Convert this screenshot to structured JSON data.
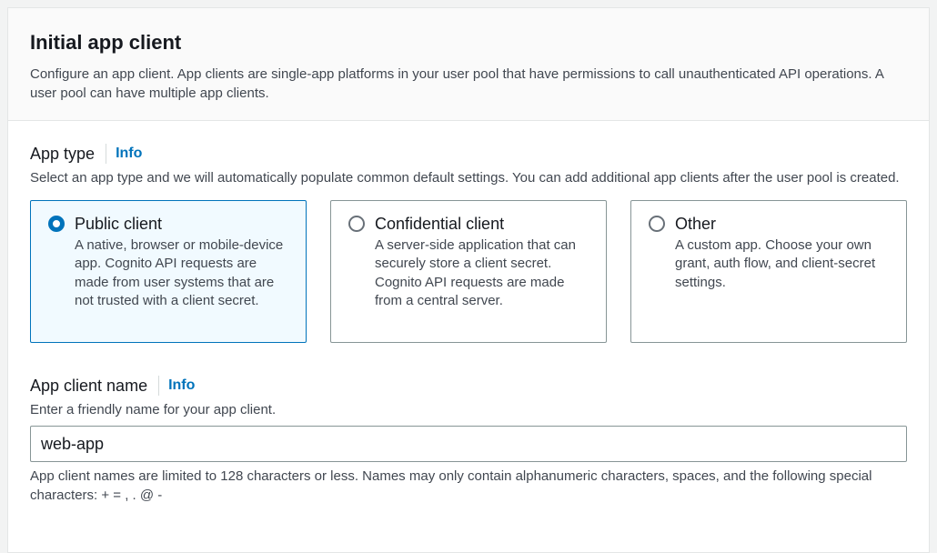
{
  "panel": {
    "title": "Initial app client",
    "description": "Configure an app client. App clients are single-app platforms in your user pool that have permissions to call unauthenticated API operations. A user pool can have multiple app clients."
  },
  "app_type": {
    "label": "App type",
    "info": "Info",
    "description": "Select an app type and we will automatically populate common default settings. You can add additional app clients after the user pool is created.",
    "options": [
      {
        "title": "Public client",
        "description": "A native, browser or mobile-device app. Cognito API requests are made from user systems that are not trusted with a client secret.",
        "selected": true
      },
      {
        "title": "Confidential client",
        "description": "A server-side application that can securely store a client secret. Cognito API requests are made from a central server.",
        "selected": false
      },
      {
        "title": "Other",
        "description": "A custom app. Choose your own grant, auth flow, and client-secret settings.",
        "selected": false
      }
    ]
  },
  "app_client_name": {
    "label": "App client name",
    "info": "Info",
    "description": "Enter a friendly name for your app client.",
    "value": "web-app",
    "constraint": "App client names are limited to 128 characters or less. Names may only contain alphanumeric characters, spaces, and the following special characters: + = , . @ -"
  },
  "colors": {
    "accent": "#0073bb",
    "selected_bg": "#f1faff",
    "border": "#879596"
  }
}
